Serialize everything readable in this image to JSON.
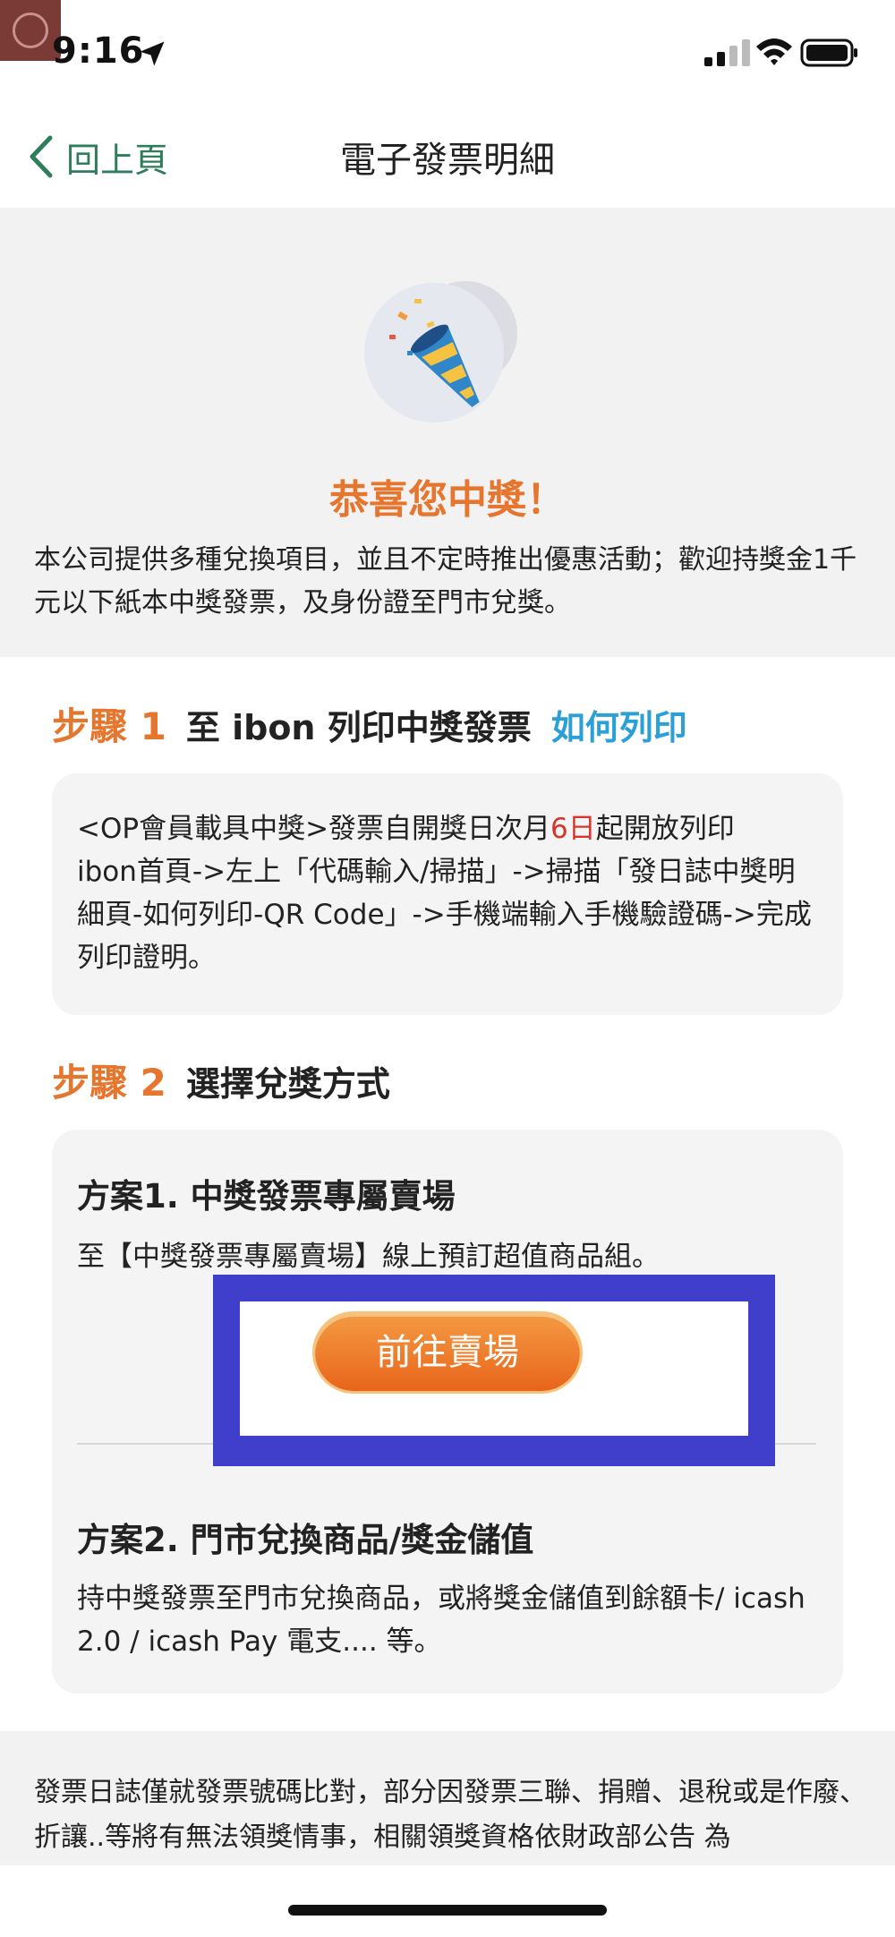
{
  "status_bar": {
    "time": "9:16"
  },
  "nav": {
    "back_label": "回上頁",
    "title": "電子發票明細"
  },
  "hero": {
    "title": "恭喜您中獎！",
    "text": "本公司提供多種兌換項目，並且不定時推出優惠活動；歡迎持獎金1千元以下紙本中獎發票，及身份證至門市兌獎。"
  },
  "step1": {
    "num": "步驟 1",
    "title": "至 ibon 列印中獎發票",
    "link": "如何列印",
    "text_prefix": "<OP會員載具中獎>發票自開獎日次月",
    "text_highlight": "6日",
    "text_suffix": "起開放列印",
    "text_rest": "ibon首頁->左上「代碼輸入/掃描」->掃描「發日誌中獎明細頁-如何列印-QR Code」->手機端輸入手機驗證碼->完成列印證明。"
  },
  "step2": {
    "num": "步驟 2",
    "title": "選擇兌獎方式",
    "plan1_title": "方案1. 中獎發票專屬賣場",
    "plan1_desc": "至【中獎發票專屬賣場】線上預訂超值商品組。",
    "plan1_button": "前往賣場",
    "plan2_title": "方案2. 門市兌換商品/獎金儲值",
    "plan2_desc": "持中獎發票至門市兌換商品，或將獎金儲值到餘額卡/ icash 2.0 / icash Pay 電支.... 等。"
  },
  "footer": {
    "text": "發票日誌僅就發票號碼比對，部分因發票三聯、捐贈、退稅或是作廢、折讓..等將有無法領獎情事，相關領獎資格依財政部公告 為"
  },
  "colors": {
    "accent_orange": "#e6762e",
    "link_blue": "#2a9fd8",
    "back_green": "#2e7d5b",
    "highlight_box": "#3f3fcc"
  }
}
